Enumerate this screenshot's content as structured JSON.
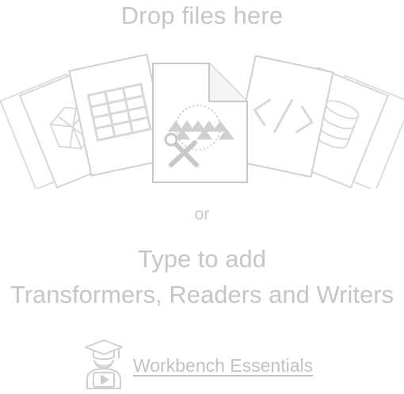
{
  "drop_zone": {
    "title": "Drop files here",
    "or_text": "or",
    "type_line_1": "Type to add",
    "type_line_2": "Transformers, Readers and Writers"
  },
  "essentials": {
    "link_label": "Workbench Essentials",
    "icon": "graduate-video-icon"
  },
  "colors": {
    "text": "#c6c6c6",
    "art_stroke": "#d2d2d2"
  }
}
